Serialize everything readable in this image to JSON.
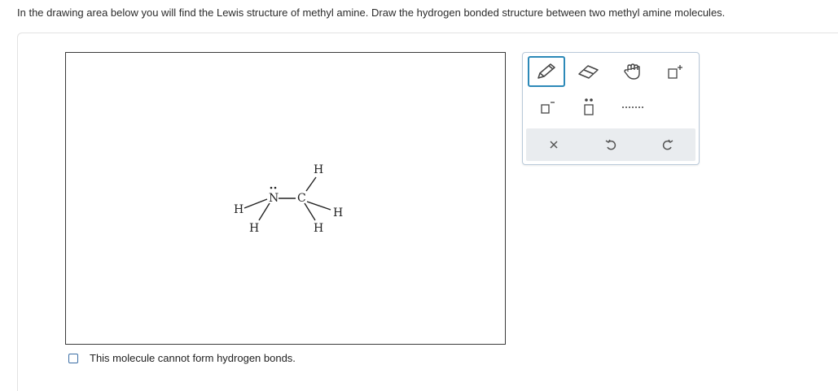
{
  "prompt": "In the drawing area below you will find the Lewis structure of methyl amine. Draw the hydrogen bonded structure between two methyl amine molecules.",
  "molecule": {
    "atoms": [
      "H",
      "N",
      "C",
      "H",
      "H",
      "H",
      "H"
    ]
  },
  "checkbox": {
    "label": "This molecule cannot form hydrogen bonds.",
    "checked": false
  },
  "toolbox": {
    "tools": [
      "pencil-icon",
      "eraser-icon",
      "hand-icon",
      "cation-charge-icon",
      "anion-charge-icon",
      "lone-pair-icon",
      "hydrogen-bond-dots-icon"
    ],
    "actions": [
      "clear-icon",
      "undo-icon",
      "redo-icon"
    ],
    "active_tool": "pencil"
  },
  "colors": {
    "accent": "#2c89b8",
    "checkbox_border": "#3b6ea5",
    "toolbar_bg": "#e9ecef"
  }
}
